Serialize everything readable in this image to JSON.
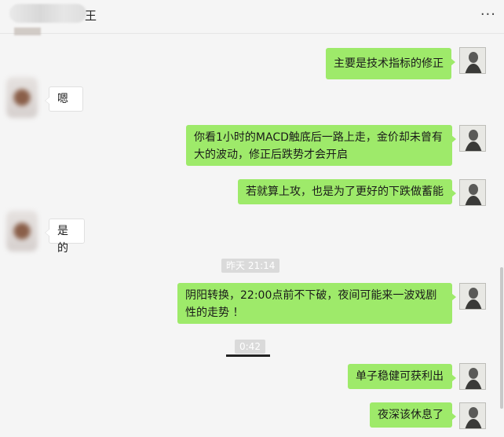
{
  "header": {
    "title_suffix": "王",
    "more_label": "···"
  },
  "colors": {
    "my_bubble": "#9eea6a",
    "their_bubble": "#ffffff",
    "background": "#f5f5f5"
  },
  "messages": [
    {
      "from": "me",
      "text": "主要是技术指标的修正"
    },
    {
      "from": "other",
      "text": "嗯"
    },
    {
      "from": "me",
      "text": "你看1小时的MACD触底后一路上走，金价却未曾有大的波动，修正后跌势才会开启"
    },
    {
      "from": "me",
      "text": "若就算上攻，也是为了更好的下跌做蓄能"
    },
    {
      "from": "other",
      "text": "是的"
    },
    {
      "from": "me",
      "text": "阴阳转换，22:00点前不下破，夜间可能来一波戏剧性的走势 ！"
    },
    {
      "from": "me",
      "text": "单子稳健可获利出"
    },
    {
      "from": "me",
      "text": "夜深该休息了"
    }
  ],
  "timestamps": {
    "yesterday": "昨天 21:14",
    "voice_time": "0:42"
  }
}
